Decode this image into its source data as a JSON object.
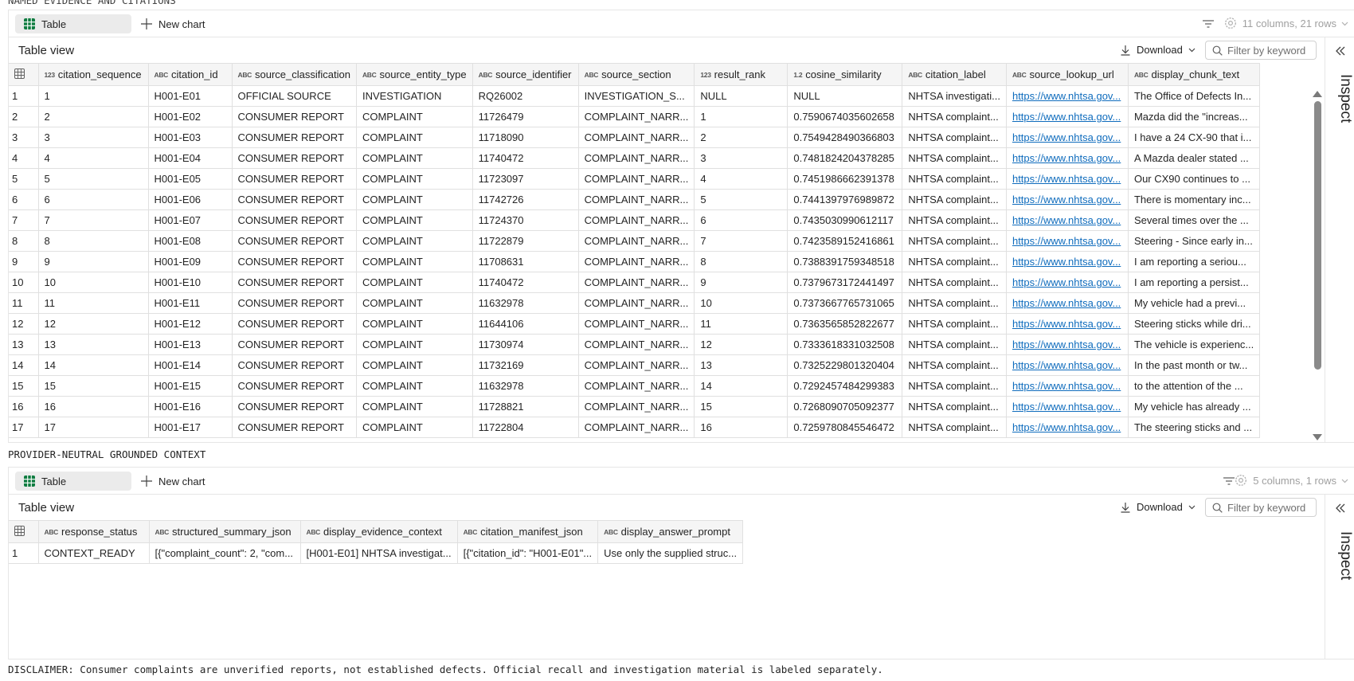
{
  "top_label": "NAMED EVIDENCE AND CITATIONS",
  "mid_label": "PROVIDER-NEUTRAL GROUNDED CONTEXT",
  "disclaimer": "DISCLAIMER: Consumer complaints are unverified reports, not established defects. Official recall and investigation material is labeled separately.",
  "colors": {
    "link": "#0f6cbd",
    "tab_active_bg": "#ebebeb",
    "grid_icon": "#107c41",
    "header_bg": "#f5f5f5"
  },
  "panel1": {
    "toolbar": {
      "table_tab": "Table",
      "new_chart": "New chart",
      "column_info": "11 columns, 21 rows"
    },
    "view_title": "Table view",
    "download_label": "Download",
    "filter_placeholder": "Filter by keyword",
    "inspect_label": "Inspect",
    "columns": [
      {
        "type": "123",
        "name": "citation_sequence"
      },
      {
        "type": "ABC",
        "name": "citation_id"
      },
      {
        "type": "ABC",
        "name": "source_classification"
      },
      {
        "type": "ABC",
        "name": "source_entity_type"
      },
      {
        "type": "ABC",
        "name": "source_identifier"
      },
      {
        "type": "ABC",
        "name": "source_section"
      },
      {
        "type": "123",
        "name": "result_rank"
      },
      {
        "type": "1.2",
        "name": "cosine_similarity"
      },
      {
        "type": "ABC",
        "name": "citation_label"
      },
      {
        "type": "ABC",
        "name": "source_lookup_url"
      },
      {
        "type": "ABC",
        "name": "display_chunk_text"
      }
    ],
    "rows": [
      [
        "1",
        "1",
        "H001-E01",
        "OFFICIAL SOURCE",
        "INVESTIGATION",
        "RQ26002",
        "INVESTIGATION_S...",
        "NULL",
        "NULL",
        "NHTSA investigati...",
        "https://www.nhtsa.gov...",
        "The Office of Defects In..."
      ],
      [
        "2",
        "2",
        "H001-E02",
        "CONSUMER REPORT",
        "COMPLAINT",
        "11726479",
        "COMPLAINT_NARR...",
        "1",
        "0.7590674035602658",
        "NHTSA complaint...",
        "https://www.nhtsa.gov...",
        "Mazda did the \"increas..."
      ],
      [
        "3",
        "3",
        "H001-E03",
        "CONSUMER REPORT",
        "COMPLAINT",
        "11718090",
        "COMPLAINT_NARR...",
        "2",
        "0.7549428490366803",
        "NHTSA complaint...",
        "https://www.nhtsa.gov...",
        "I have a 24 CX-90 that i..."
      ],
      [
        "4",
        "4",
        "H001-E04",
        "CONSUMER REPORT",
        "COMPLAINT",
        "11740472",
        "COMPLAINT_NARR...",
        "3",
        "0.7481824204378285",
        "NHTSA complaint...",
        "https://www.nhtsa.gov...",
        "A Mazda dealer stated ..."
      ],
      [
        "5",
        "5",
        "H001-E05",
        "CONSUMER REPORT",
        "COMPLAINT",
        "11723097",
        "COMPLAINT_NARR...",
        "4",
        "0.7451986662391378",
        "NHTSA complaint...",
        "https://www.nhtsa.gov...",
        "Our CX90 continues to ..."
      ],
      [
        "6",
        "6",
        "H001-E06",
        "CONSUMER REPORT",
        "COMPLAINT",
        "11742726",
        "COMPLAINT_NARR...",
        "5",
        "0.7441397976989872",
        "NHTSA complaint...",
        "https://www.nhtsa.gov...",
        "There is momentary inc..."
      ],
      [
        "7",
        "7",
        "H001-E07",
        "CONSUMER REPORT",
        "COMPLAINT",
        "11724370",
        "COMPLAINT_NARR...",
        "6",
        "0.7435030990612117",
        "NHTSA complaint...",
        "https://www.nhtsa.gov...",
        "Several times over the ..."
      ],
      [
        "8",
        "8",
        "H001-E08",
        "CONSUMER REPORT",
        "COMPLAINT",
        "11722879",
        "COMPLAINT_NARR...",
        "7",
        "0.7423589152416861",
        "NHTSA complaint...",
        "https://www.nhtsa.gov...",
        "Steering - Since early in..."
      ],
      [
        "9",
        "9",
        "H001-E09",
        "CONSUMER REPORT",
        "COMPLAINT",
        "11708631",
        "COMPLAINT_NARR...",
        "8",
        "0.7388391759348518",
        "NHTSA complaint...",
        "https://www.nhtsa.gov...",
        "I am reporting a seriou..."
      ],
      [
        "10",
        "10",
        "H001-E10",
        "CONSUMER REPORT",
        "COMPLAINT",
        "11740472",
        "COMPLAINT_NARR...",
        "9",
        "0.7379673172441497",
        "NHTSA complaint...",
        "https://www.nhtsa.gov...",
        "I am reporting a persist..."
      ],
      [
        "11",
        "11",
        "H001-E11",
        "CONSUMER REPORT",
        "COMPLAINT",
        "11632978",
        "COMPLAINT_NARR...",
        "10",
        "0.7373667765731065",
        "NHTSA complaint...",
        "https://www.nhtsa.gov...",
        "My vehicle had a previ..."
      ],
      [
        "12",
        "12",
        "H001-E12",
        "CONSUMER REPORT",
        "COMPLAINT",
        "11644106",
        "COMPLAINT_NARR...",
        "11",
        "0.7363565852822677",
        "NHTSA complaint...",
        "https://www.nhtsa.gov...",
        "Steering sticks while dri..."
      ],
      [
        "13",
        "13",
        "H001-E13",
        "CONSUMER REPORT",
        "COMPLAINT",
        "11730974",
        "COMPLAINT_NARR...",
        "12",
        "0.7333618331032508",
        "NHTSA complaint...",
        "https://www.nhtsa.gov...",
        "The vehicle is experienc..."
      ],
      [
        "14",
        "14",
        "H001-E14",
        "CONSUMER REPORT",
        "COMPLAINT",
        "11732169",
        "COMPLAINT_NARR...",
        "13",
        "0.7325229801320404",
        "NHTSA complaint...",
        "https://www.nhtsa.gov...",
        "In the past month or tw..."
      ],
      [
        "15",
        "15",
        "H001-E15",
        "CONSUMER REPORT",
        "COMPLAINT",
        "11632978",
        "COMPLAINT_NARR...",
        "14",
        "0.7292457484299383",
        "NHTSA complaint...",
        "https://www.nhtsa.gov...",
        "to the attention of the ..."
      ],
      [
        "16",
        "16",
        "H001-E16",
        "CONSUMER REPORT",
        "COMPLAINT",
        "11728821",
        "COMPLAINT_NARR...",
        "15",
        "0.7268090705092377",
        "NHTSA complaint...",
        "https://www.nhtsa.gov...",
        "My vehicle has already ..."
      ],
      [
        "17",
        "17",
        "H001-E17",
        "CONSUMER REPORT",
        "COMPLAINT",
        "11722804",
        "COMPLAINT_NARR...",
        "16",
        "0.7259780845546472",
        "NHTSA complaint...",
        "https://www.nhtsa.gov...",
        "The steering sticks and ..."
      ]
    ]
  },
  "panel2": {
    "toolbar": {
      "table_tab": "Table",
      "new_chart": "New chart",
      "column_info": "5 columns, 1 rows"
    },
    "view_title": "Table view",
    "download_label": "Download",
    "filter_placeholder": "Filter by keyword",
    "inspect_label": "Inspect",
    "columns": [
      {
        "type": "ABC",
        "name": "response_status"
      },
      {
        "type": "ABC",
        "name": "structured_summary_json"
      },
      {
        "type": "ABC",
        "name": "display_evidence_context"
      },
      {
        "type": "ABC",
        "name": "citation_manifest_json"
      },
      {
        "type": "ABC",
        "name": "display_answer_prompt"
      }
    ],
    "rows": [
      [
        "1",
        "CONTEXT_READY",
        "[{\"complaint_count\": 2, \"com...",
        "[H001-E01] NHTSA investigat...",
        "[{\"citation_id\": \"H001-E01\"...",
        "Use only the supplied struc..."
      ]
    ]
  }
}
